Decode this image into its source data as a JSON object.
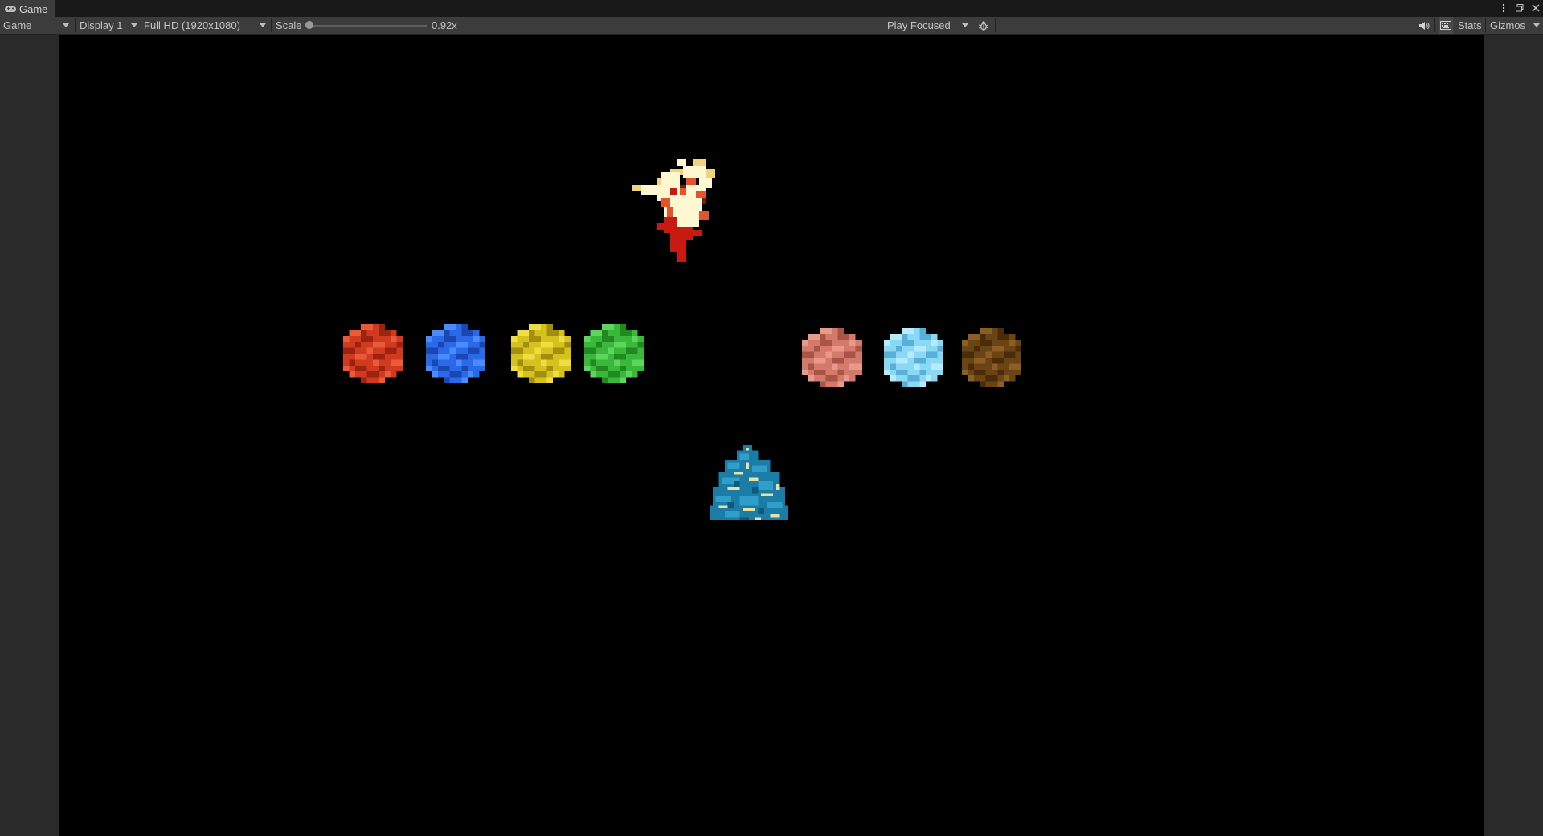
{
  "tab": {
    "title": "Game",
    "icon": "gamepad-icon"
  },
  "window_controls": [
    "kebab-menu-icon",
    "maximize-icon",
    "close-icon"
  ],
  "toolbar": {
    "view_mode": "Game",
    "display": "Display 1",
    "resolution": "Full HD (1920x1080)",
    "scale_label": "Scale",
    "scale_value": "0.92x",
    "scale_fraction": 0.0,
    "play_mode": "Play Focused",
    "debug_icon": "bug-icon",
    "audio_icon": "speaker-icon",
    "gizmo_grid_icon": "keyboard-icon",
    "stats_label": "Stats",
    "gizmos_label": "Gizmos"
  },
  "scene": {
    "background": "#000000",
    "sprites": [
      {
        "name": "fire-spirit",
        "palette": [
          "#fff6d2",
          "#f2d27a",
          "#e0552e",
          "#c81a10"
        ]
      },
      {
        "name": "water-spirit",
        "palette": [
          "#1b7ca6",
          "#2f9fc9",
          "#e8e0a0",
          "#0e5a7d"
        ]
      }
    ],
    "orbs": [
      {
        "name": "red-orb",
        "color": "#d23a20",
        "dark": "#9a2410",
        "light": "#e85a3a"
      },
      {
        "name": "blue-orb",
        "color": "#2a6ae8",
        "dark": "#1a48b0",
        "light": "#4a8cff"
      },
      {
        "name": "yellow-orb",
        "color": "#d6c21c",
        "dark": "#a28e10",
        "light": "#eede44"
      },
      {
        "name": "green-orb",
        "color": "#3ab83a",
        "dark": "#228822",
        "light": "#5ed65e"
      },
      {
        "name": "pink-orb",
        "color": "#d47a6a",
        "dark": "#a85446",
        "light": "#e89a8a"
      },
      {
        "name": "cyan-orb",
        "color": "#8ad8f4",
        "dark": "#58b0d8",
        "light": "#b4ecff"
      },
      {
        "name": "brown-orb",
        "color": "#6a4414",
        "dark": "#4a2c08",
        "light": "#8a5e24"
      }
    ]
  }
}
